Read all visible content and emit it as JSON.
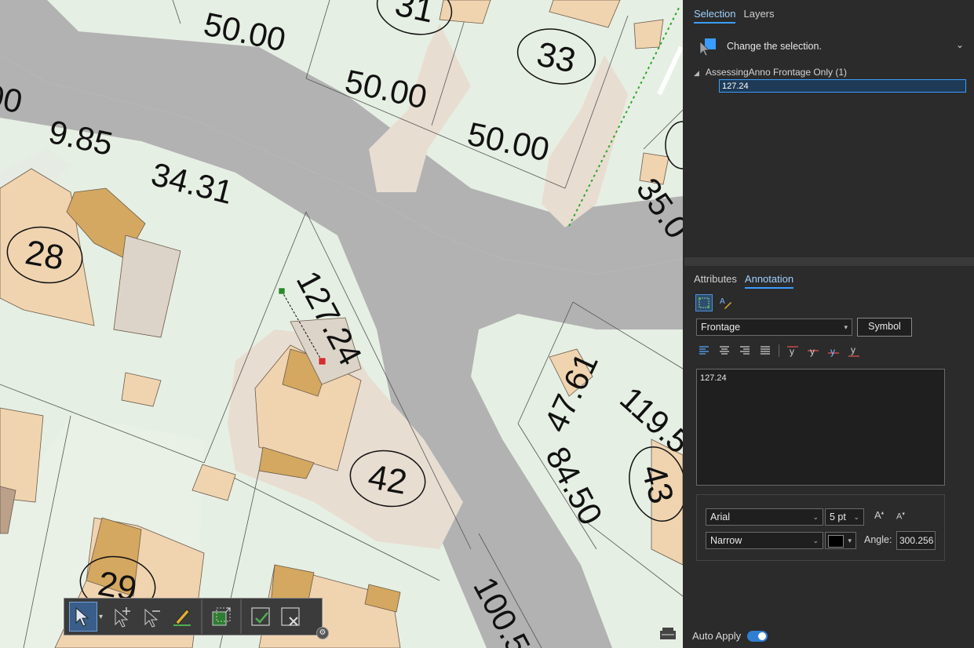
{
  "map": {
    "labels": {
      "lot_28": "28",
      "lot_31": "31",
      "lot_33": "33",
      "lot_42": "42",
      "lot_43": "43",
      "lot_29": "29",
      "d_50_a": "50.00",
      "d_50_b": "50.00",
      "d_50_c": "50.00",
      "d_9_85": "9.85",
      "d_34_31": "34.31",
      "d_35": "35.0",
      "d_00": "00",
      "d_127_24": "127.24",
      "d_47_61": "47.61",
      "d_119": "119.5",
      "d_84_50": "84.50",
      "d_100": "100.5"
    }
  },
  "selection_tabs": [
    "Selection",
    "Layers"
  ],
  "selection": {
    "prompt": "Change the selection.",
    "group_label": "AssessingAnno Frontage Only (1)",
    "selected_item": "127.24"
  },
  "detail_tabs": [
    "Attributes",
    "Annotation"
  ],
  "annotation": {
    "class_value": "Frontage",
    "symbol_button": "Symbol",
    "text_value": "127.24",
    "font_family": "Arial",
    "font_size": "5 pt",
    "font_style": "Narrow",
    "angle_label": "Angle:",
    "angle_value": "300.256",
    "text_color": "#000000"
  },
  "auto_apply_label": "Auto Apply",
  "colors": {
    "accent": "#3b9cff",
    "map_bg": "#e6efe3",
    "road": "#b2b2b2",
    "building": "#f0d4b0"
  }
}
